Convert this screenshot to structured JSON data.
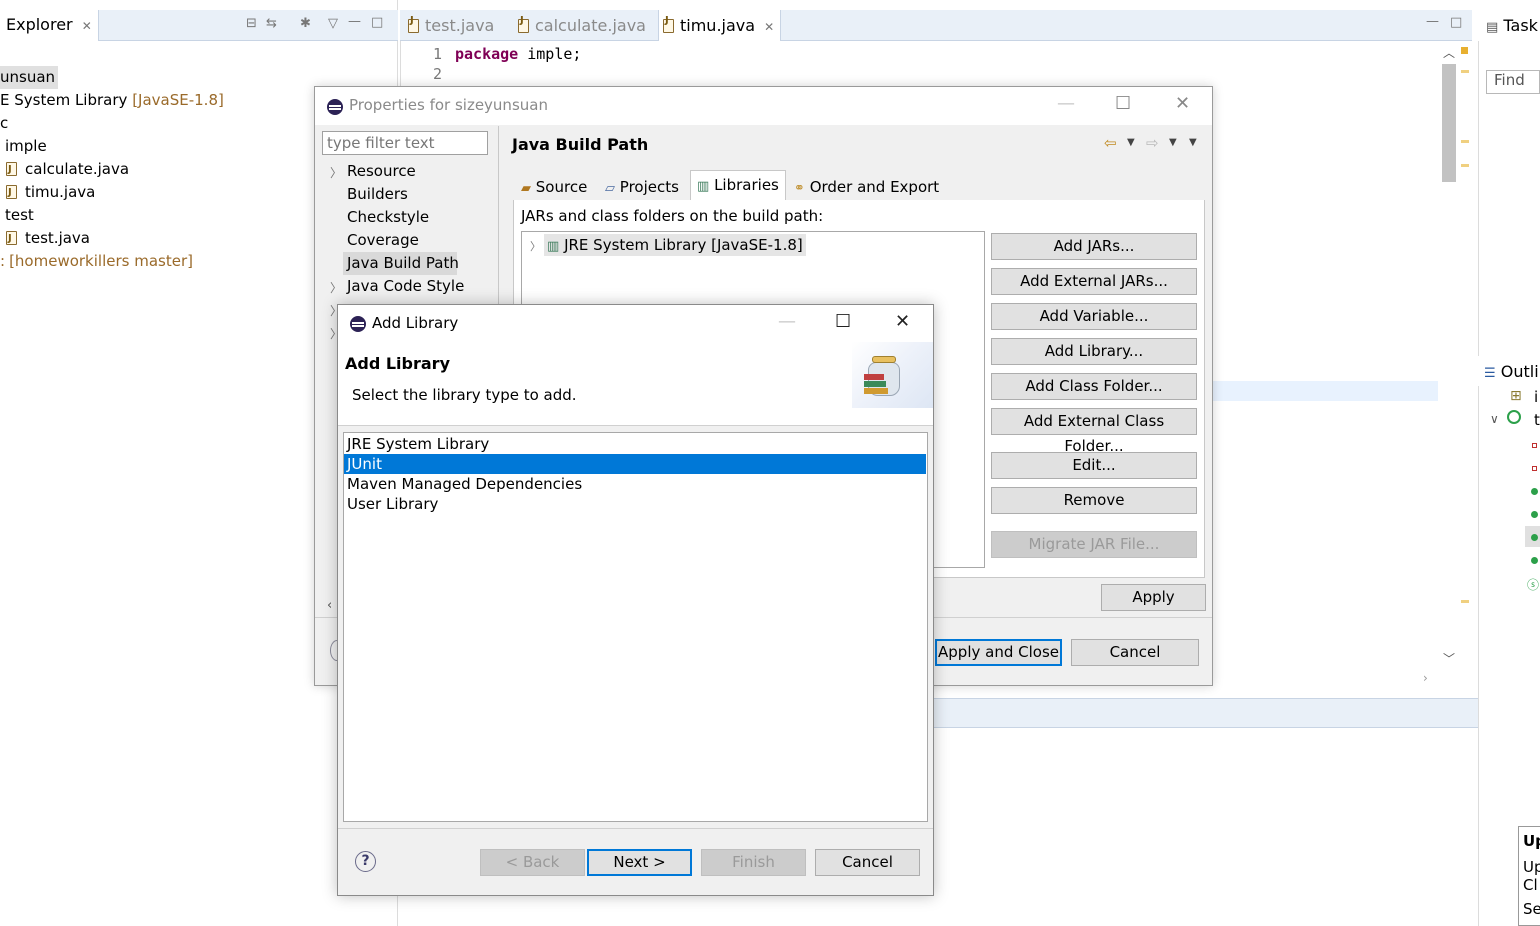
{
  "explorer": {
    "title": "Explorer",
    "tree": [
      {
        "label": "unsuan",
        "kind": "project",
        "selected": true
      },
      {
        "label": "E System Library",
        "decor": "[JavaSE-1.8]",
        "kind": "library"
      },
      {
        "label": "c",
        "kind": "folder"
      },
      {
        "label": "imple",
        "kind": "package"
      },
      {
        "label": "calculate.java",
        "kind": "java"
      },
      {
        "label": "timu.java",
        "kind": "java"
      },
      {
        "label": "test",
        "kind": "package"
      },
      {
        "label": "test.java",
        "kind": "java"
      },
      {
        "label": "",
        "decor": "[homeworkillers master]",
        "kind": "git"
      }
    ]
  },
  "editor": {
    "tabs": [
      {
        "label": "test.java",
        "active": false
      },
      {
        "label": "calculate.java",
        "active": false
      },
      {
        "label": "timu.java",
        "active": true
      }
    ],
    "lines": [
      {
        "num": "1",
        "keyword": "package",
        "rest": " imple;"
      },
      {
        "num": "2",
        "keyword": "",
        "rest": ""
      }
    ]
  },
  "right_panel": {
    "task_tab": "Task",
    "find_placeholder": "Find",
    "outline_tab": "Outli",
    "popup": {
      "title": "Up",
      "line1": "Up",
      "line2": "Cl",
      "line3": "Se"
    }
  },
  "properties_dialog": {
    "title": "Properties for sizeyunsuan",
    "filter_placeholder": "type filter text",
    "nav": [
      {
        "label": "Resource",
        "expandable": true
      },
      {
        "label": "Builders",
        "expandable": false
      },
      {
        "label": "Checkstyle",
        "expandable": false
      },
      {
        "label": "Coverage",
        "expandable": false
      },
      {
        "label": "Java Build Path",
        "expandable": false,
        "selected": true
      },
      {
        "label": "Java Code Style",
        "expandable": true
      }
    ],
    "page_title": "Java Build Path",
    "tabs": [
      {
        "label": "Source",
        "active": false
      },
      {
        "label": "Projects",
        "active": false
      },
      {
        "label": "Libraries",
        "active": true
      },
      {
        "label": "Order and Export",
        "active": false
      }
    ],
    "jars_label": "JARs and class folders on the build path:",
    "build_path_entries": [
      "JRE System Library [JavaSE-1.8]"
    ],
    "buttons": {
      "add_jars": "Add JARs...",
      "add_external_jars": "Add External JARs...",
      "add_variable": "Add Variable...",
      "add_library": "Add Library...",
      "add_class_folder": "Add Class Folder...",
      "add_external_class_folder": "Add External Class Folder...",
      "edit": "Edit...",
      "remove": "Remove",
      "migrate_jar": "Migrate JAR File...",
      "apply": "Apply",
      "apply_and_close": "Apply and Close",
      "cancel": "Cancel"
    }
  },
  "add_library_dialog": {
    "window_title": "Add Library",
    "header_title": "Add Library",
    "header_desc": "Select the library type to add.",
    "library_types": [
      {
        "label": "JRE System Library",
        "selected": false
      },
      {
        "label": "JUnit",
        "selected": true
      },
      {
        "label": "Maven Managed Dependencies",
        "selected": false
      },
      {
        "label": "User Library",
        "selected": false
      }
    ],
    "buttons": {
      "back": "< Back",
      "next": "Next >",
      "finish": "Finish",
      "cancel": "Cancel"
    }
  },
  "colors": {
    "selection": "#0078d7",
    "keyword": "#7f0055",
    "tab_bar": "#e9f0f8",
    "dialog_bg": "#f0f0f0"
  }
}
